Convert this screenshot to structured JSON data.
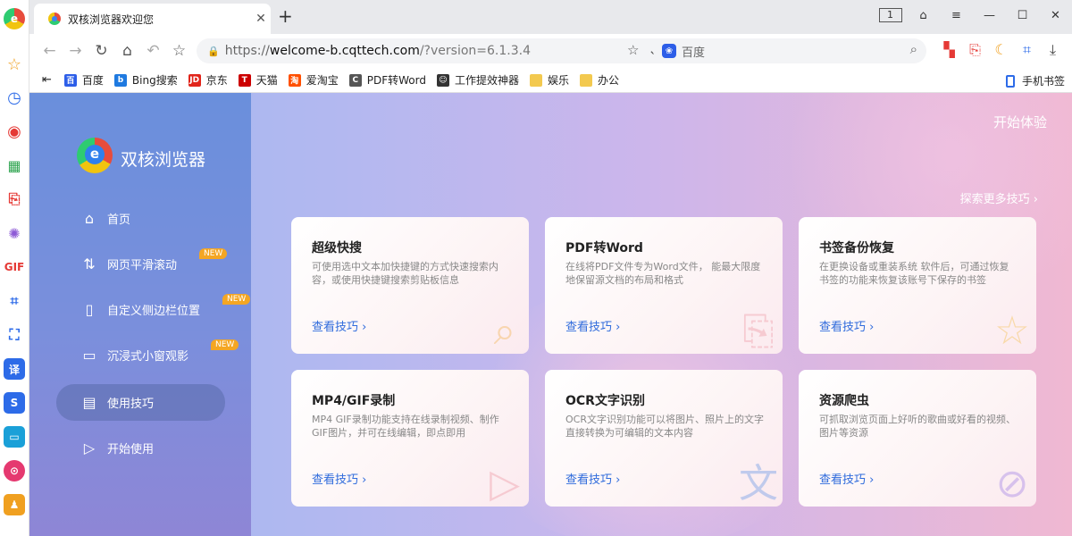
{
  "browser": {
    "tab_title": "双核浏览器欢迎您",
    "tab_count": "1",
    "url_proto": "https://",
    "url_domain": "welcome-b.cqttech.com",
    "url_query": "/?version=6.1.3.4",
    "search_engine": "百度"
  },
  "bookmarks": [
    {
      "label": "百度",
      "color": "#2d5ee8",
      "glyph": "百"
    },
    {
      "label": "Bing搜索",
      "color": "#1f7ae0",
      "glyph": "b"
    },
    {
      "label": "京东",
      "color": "#e1251b",
      "glyph": "JD"
    },
    {
      "label": "天猫",
      "color": "#c00",
      "glyph": "T"
    },
    {
      "label": "爱淘宝",
      "color": "#ff5000",
      "glyph": "淘"
    },
    {
      "label": "PDF转Word",
      "color": "#555",
      "glyph": "C"
    },
    {
      "label": "工作提效神器",
      "color": "#333",
      "glyph": "☺"
    },
    {
      "label": "娱乐",
      "color": "#f3c94f",
      "glyph": ""
    },
    {
      "label": "办公",
      "color": "#f3c94f",
      "glyph": ""
    }
  ],
  "mobile_bookmarks": "手机书签",
  "sidebar": {
    "brand": "双核浏览器",
    "items": [
      {
        "label": "首页",
        "icon": "home-icon",
        "badge": ""
      },
      {
        "label": "网页平滑滚动",
        "icon": "scroll-icon",
        "badge": "NEW"
      },
      {
        "label": "自定义侧边栏位置",
        "icon": "sidebar-icon",
        "badge": "NEW"
      },
      {
        "label": "沉浸式小窗观影",
        "icon": "window-icon",
        "badge": "NEW"
      },
      {
        "label": "使用技巧",
        "icon": "book-icon",
        "badge": ""
      },
      {
        "label": "开始使用",
        "icon": "play-icon",
        "badge": ""
      }
    ]
  },
  "header": {
    "start_label": "开始体验",
    "more_label": "探索更多技巧 ›"
  },
  "cards": [
    {
      "title": "超级快搜",
      "desc": "可使用选中文本加快捷键的方式快速搜索内容，或使用快捷键搜索剪贴板信息",
      "cta": "查看技巧 ›",
      "icon": "magnifier-icon"
    },
    {
      "title": "PDF转Word",
      "desc": "在线将PDF文件专为Word文件， 能最大限度地保留源文档的布局和格式",
      "cta": "查看技巧 ›",
      "icon": "pdf-icon"
    },
    {
      "title": "书签备份恢复",
      "desc": "在更换设备或重装系统 软件后，可通过恢复书签的功能来恢复该账号下保存的书签",
      "cta": "查看技巧 ›",
      "icon": "star-icon"
    },
    {
      "title": "MP4/GIF录制",
      "desc": "MP4 GIF录制功能支持在线录制视频、制作GIF图片，并可在线编辑，即点即用",
      "cta": "查看技巧 ›",
      "icon": "video-icon"
    },
    {
      "title": "OCR文字识别",
      "desc": "OCR文字识别功能可以将图片、照片上的文字直接转换为可编辑的文本内容",
      "cta": "查看技巧 ›",
      "icon": "text-scan-icon"
    },
    {
      "title": "资源爬虫",
      "desc": "可抓取浏览页面上好听的歌曲或好看的视频、图片等资源",
      "cta": "查看技巧 ›",
      "icon": "bug-icon"
    }
  ]
}
